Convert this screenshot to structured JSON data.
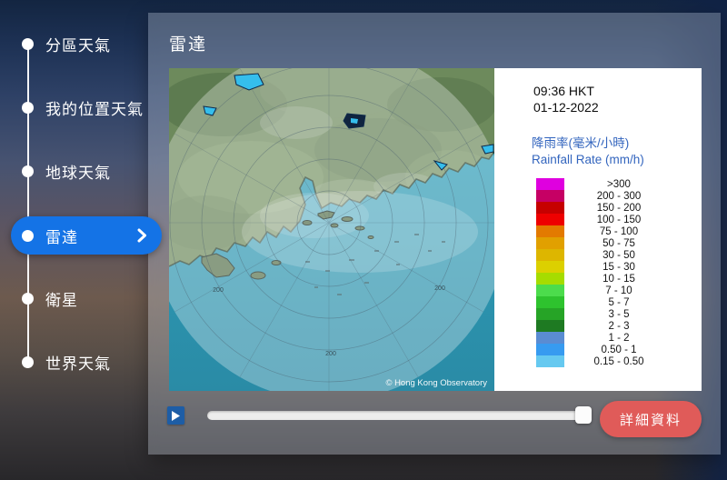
{
  "sidebar": {
    "items": [
      {
        "key": "district-weather",
        "label": "分區天氣",
        "active": false
      },
      {
        "key": "my-location-weather",
        "label": "我的位置天氣",
        "active": false
      },
      {
        "key": "earth-weather",
        "label": "地球天氣",
        "active": false
      },
      {
        "key": "radar",
        "label": "雷達",
        "active": true
      },
      {
        "key": "satellite",
        "label": "衛星",
        "active": false
      },
      {
        "key": "world-weather",
        "label": "世界天氣",
        "active": false
      }
    ]
  },
  "panel": {
    "title": "雷達"
  },
  "radar_view": {
    "time": "09:36 HKT",
    "date": "01-12-2022",
    "legend_title_zh": "降雨率(毫米/小時)",
    "legend_title_en": "Rainfall Rate (mm/h)",
    "range_ring_label": "200",
    "copyright": "© Hong Kong Observatory",
    "scale": [
      {
        "label": ">300",
        "color": "#DF00DF"
      },
      {
        "label": "200 - 300",
        "color": "#C60064"
      },
      {
        "label": "150 - 200",
        "color": "#C60000"
      },
      {
        "label": "100 - 150",
        "color": "#EE0000"
      },
      {
        "label": "75 - 100",
        "color": "#E37A00"
      },
      {
        "label": "50 - 75",
        "color": "#E1A000"
      },
      {
        "label": "30 - 50",
        "color": "#DDB600"
      },
      {
        "label": "15 - 30",
        "color": "#DCD000"
      },
      {
        "label": "10 - 15",
        "color": "#A6DC00"
      },
      {
        "label": "7 - 10",
        "color": "#4CDC4C"
      },
      {
        "label": "5 - 7",
        "color": "#2EC32E"
      },
      {
        "label": "3 - 5",
        "color": "#26A426"
      },
      {
        "label": "2 - 3",
        "color": "#1E7A22"
      },
      {
        "label": "1 - 2",
        "color": "#5A8CD2"
      },
      {
        "label": "0.50 - 1",
        "color": "#379BF0"
      },
      {
        "label": "0.15 - 0.50",
        "color": "#66C9F0"
      }
    ]
  },
  "controls": {
    "detail_label": "詳細資料"
  },
  "colors": {
    "active_item": "#1473E6",
    "detail_button": "#E05B59",
    "play_button": "#1D5DA6",
    "legend_title": "#3365BE"
  }
}
